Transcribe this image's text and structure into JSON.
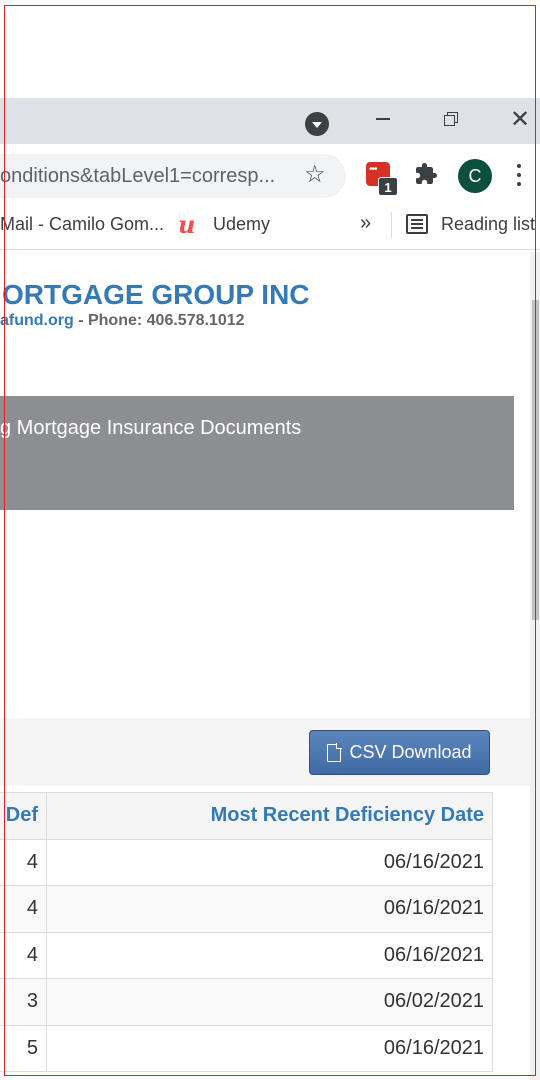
{
  "browser": {
    "url_text": "onditions&tabLevel1=corresp...",
    "extension_badge": "1",
    "avatar_letter": "C",
    "bookmarks": {
      "gmail": "Mail - Camilo Gom...",
      "udemy": "Udemy",
      "more": "»",
      "reading_list": "Reading list"
    }
  },
  "page": {
    "company_name": "ORTGAGE GROUP INC",
    "contact_link": "afund.org",
    "contact_phone": " - Phone: 406.578.1012",
    "banner_text": "g Mortgage Insurance Documents",
    "csv_button": "CSV Download"
  },
  "table": {
    "headers": [
      "Def",
      "Most Recent Deficiency Date"
    ],
    "rows": [
      [
        "4",
        "06/16/2021"
      ],
      [
        "4",
        "06/16/2021"
      ],
      [
        "4",
        "06/16/2021"
      ],
      [
        "3",
        "06/02/2021"
      ],
      [
        "5",
        "06/16/2021"
      ]
    ]
  }
}
